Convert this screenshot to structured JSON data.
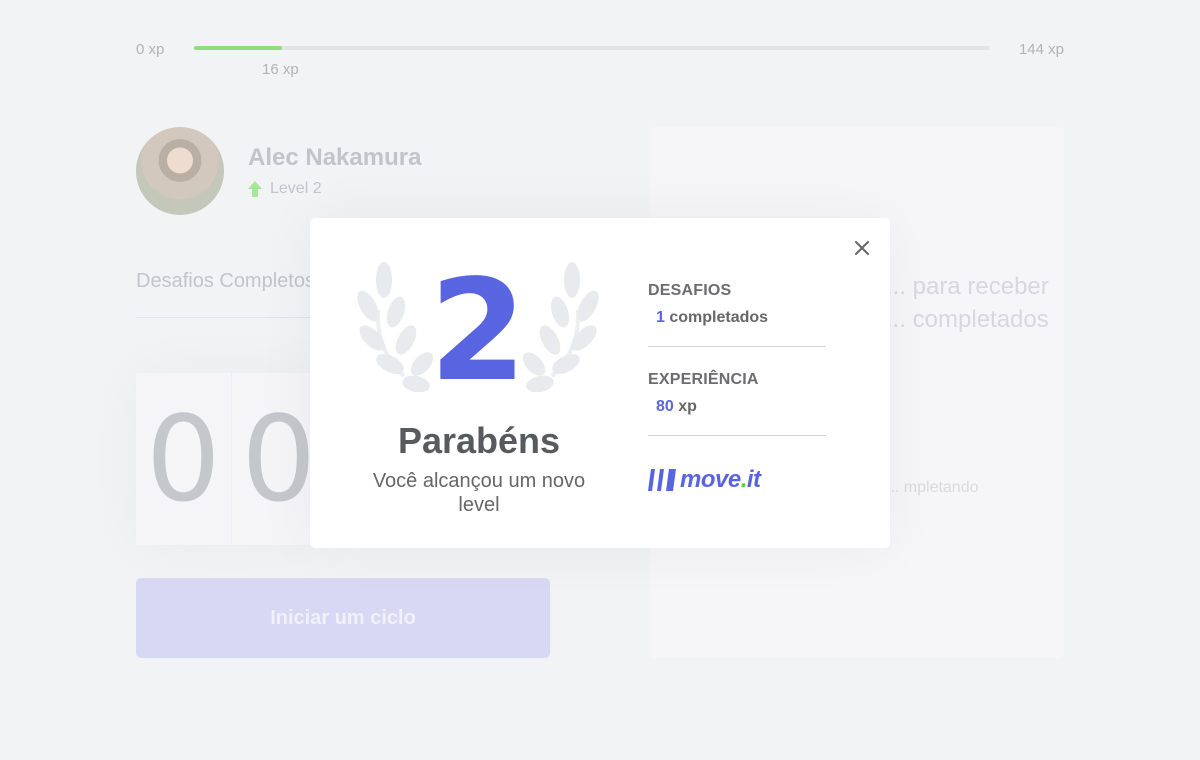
{
  "xp": {
    "min_label": "0 xp",
    "max_label": "144 xp",
    "current_label": "16 xp",
    "current": 16,
    "max": 144
  },
  "profile": {
    "name": "Alec Nakamura",
    "level_label": "Level 2"
  },
  "completed_challenges": {
    "label": "Desafios Completos"
  },
  "countdown": {
    "minutes": [
      "0",
      "0"
    ]
  },
  "cycle_button": {
    "label": "Iniciar um ciclo"
  },
  "challenge_box": {
    "title": "... para receber ... completados",
    "hint": "... mpletando"
  },
  "modal": {
    "level": "2",
    "title": "Parabéns",
    "subtitle": "Você alcançou um novo level",
    "stats": [
      {
        "label": "DESAFIOS",
        "value": "1",
        "unit": "completados"
      },
      {
        "label": "EXPERIÊNCIA",
        "value": "80",
        "unit": "xp"
      }
    ],
    "brand": {
      "text": "move",
      "dot": ".",
      "suffix": "it"
    }
  },
  "colors": {
    "accent": "#5965e0",
    "success": "#4cd62b",
    "background": "#f2f3f5",
    "title": "#595a5e"
  },
  "icons": {
    "close": "close-icon",
    "level": "level-up-arrow-icon",
    "laurel": "laurel-wreath-icon",
    "brand": "move-it-logo-icon"
  }
}
